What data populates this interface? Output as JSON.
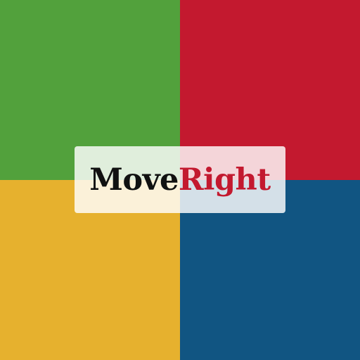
{
  "quadrants": {
    "top_left": "#52A13C",
    "top_right": "#C3192F",
    "bottom_left": "#E6B12E",
    "bottom_right": "#115582"
  },
  "logo": {
    "part1": "Move",
    "part2": "Right",
    "part1_color": "#111111",
    "part2_color": "#C3192F",
    "card_background": "#FFFFFF"
  }
}
